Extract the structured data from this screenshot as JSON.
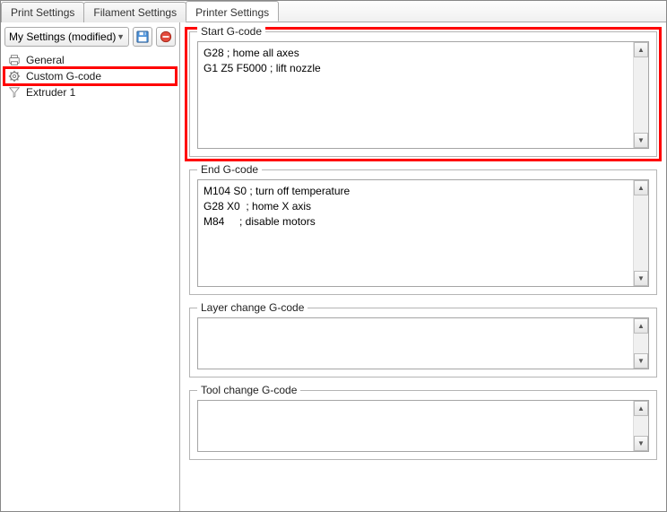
{
  "tabs": {
    "print": "Print Settings",
    "filament": "Filament Settings",
    "printer": "Printer Settings"
  },
  "sidebar": {
    "preset": "My Settings (modified)",
    "items": [
      {
        "label": "General"
      },
      {
        "label": "Custom G-code"
      },
      {
        "label": "Extruder 1"
      }
    ]
  },
  "panels": {
    "start": {
      "title": "Start G-code",
      "value": "G28 ; home all axes\nG1 Z5 F5000 ; lift nozzle"
    },
    "end": {
      "title": "End G-code",
      "value": "M104 S0 ; turn off temperature\nG28 X0  ; home X axis\nM84     ; disable motors"
    },
    "layer": {
      "title": "Layer change G-code",
      "value": ""
    },
    "tool": {
      "title": "Tool change G-code",
      "value": ""
    }
  }
}
